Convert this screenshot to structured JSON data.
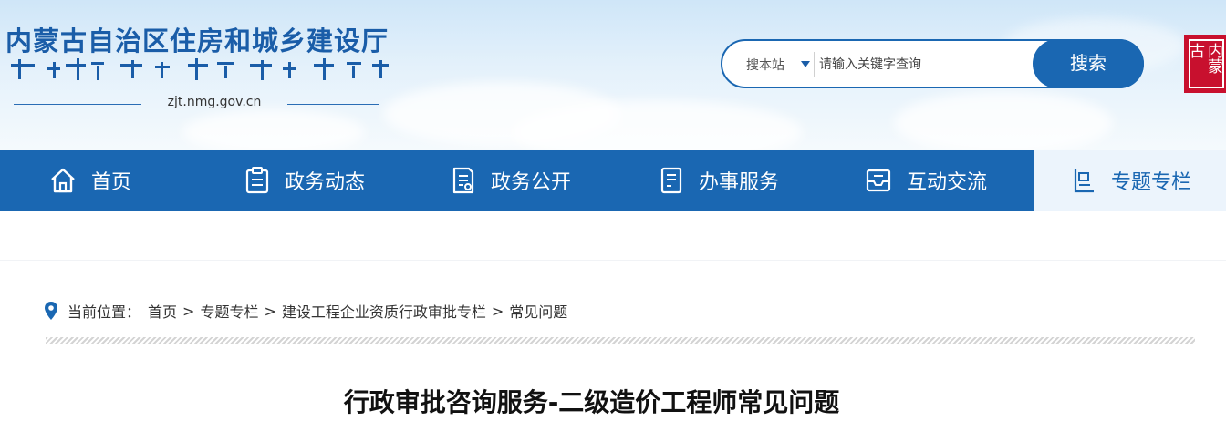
{
  "header": {
    "site_name": "内蒙古自治区住房和城乡建设厅",
    "domain": "zjt.nmg.gov.cn",
    "seal_text": "内蒙古"
  },
  "search": {
    "scope": "搜本站",
    "placeholder": "请输入关键字查询",
    "button_label": "搜索"
  },
  "nav": {
    "items": [
      {
        "label": "首页",
        "icon": "home-icon"
      },
      {
        "label": "政务动态",
        "icon": "clipboard-icon"
      },
      {
        "label": "政务公开",
        "icon": "document-icon"
      },
      {
        "label": "办事服务",
        "icon": "form-icon"
      },
      {
        "label": "互动交流",
        "icon": "mailbox-icon"
      },
      {
        "label": "专题专栏",
        "icon": "column-icon",
        "active": true
      }
    ]
  },
  "breadcrumb": {
    "prefix": "当前位置：",
    "items": [
      "首页",
      "专题专栏",
      "建设工程企业资质行政审批专栏",
      "常见问题"
    ]
  },
  "article": {
    "title": "行政审批咨询服务-二级造价工程师常见问题"
  },
  "colors": {
    "primary": "#1a67b2",
    "seal_red": "#c8102e",
    "header_sky": "#cfe6f8"
  }
}
